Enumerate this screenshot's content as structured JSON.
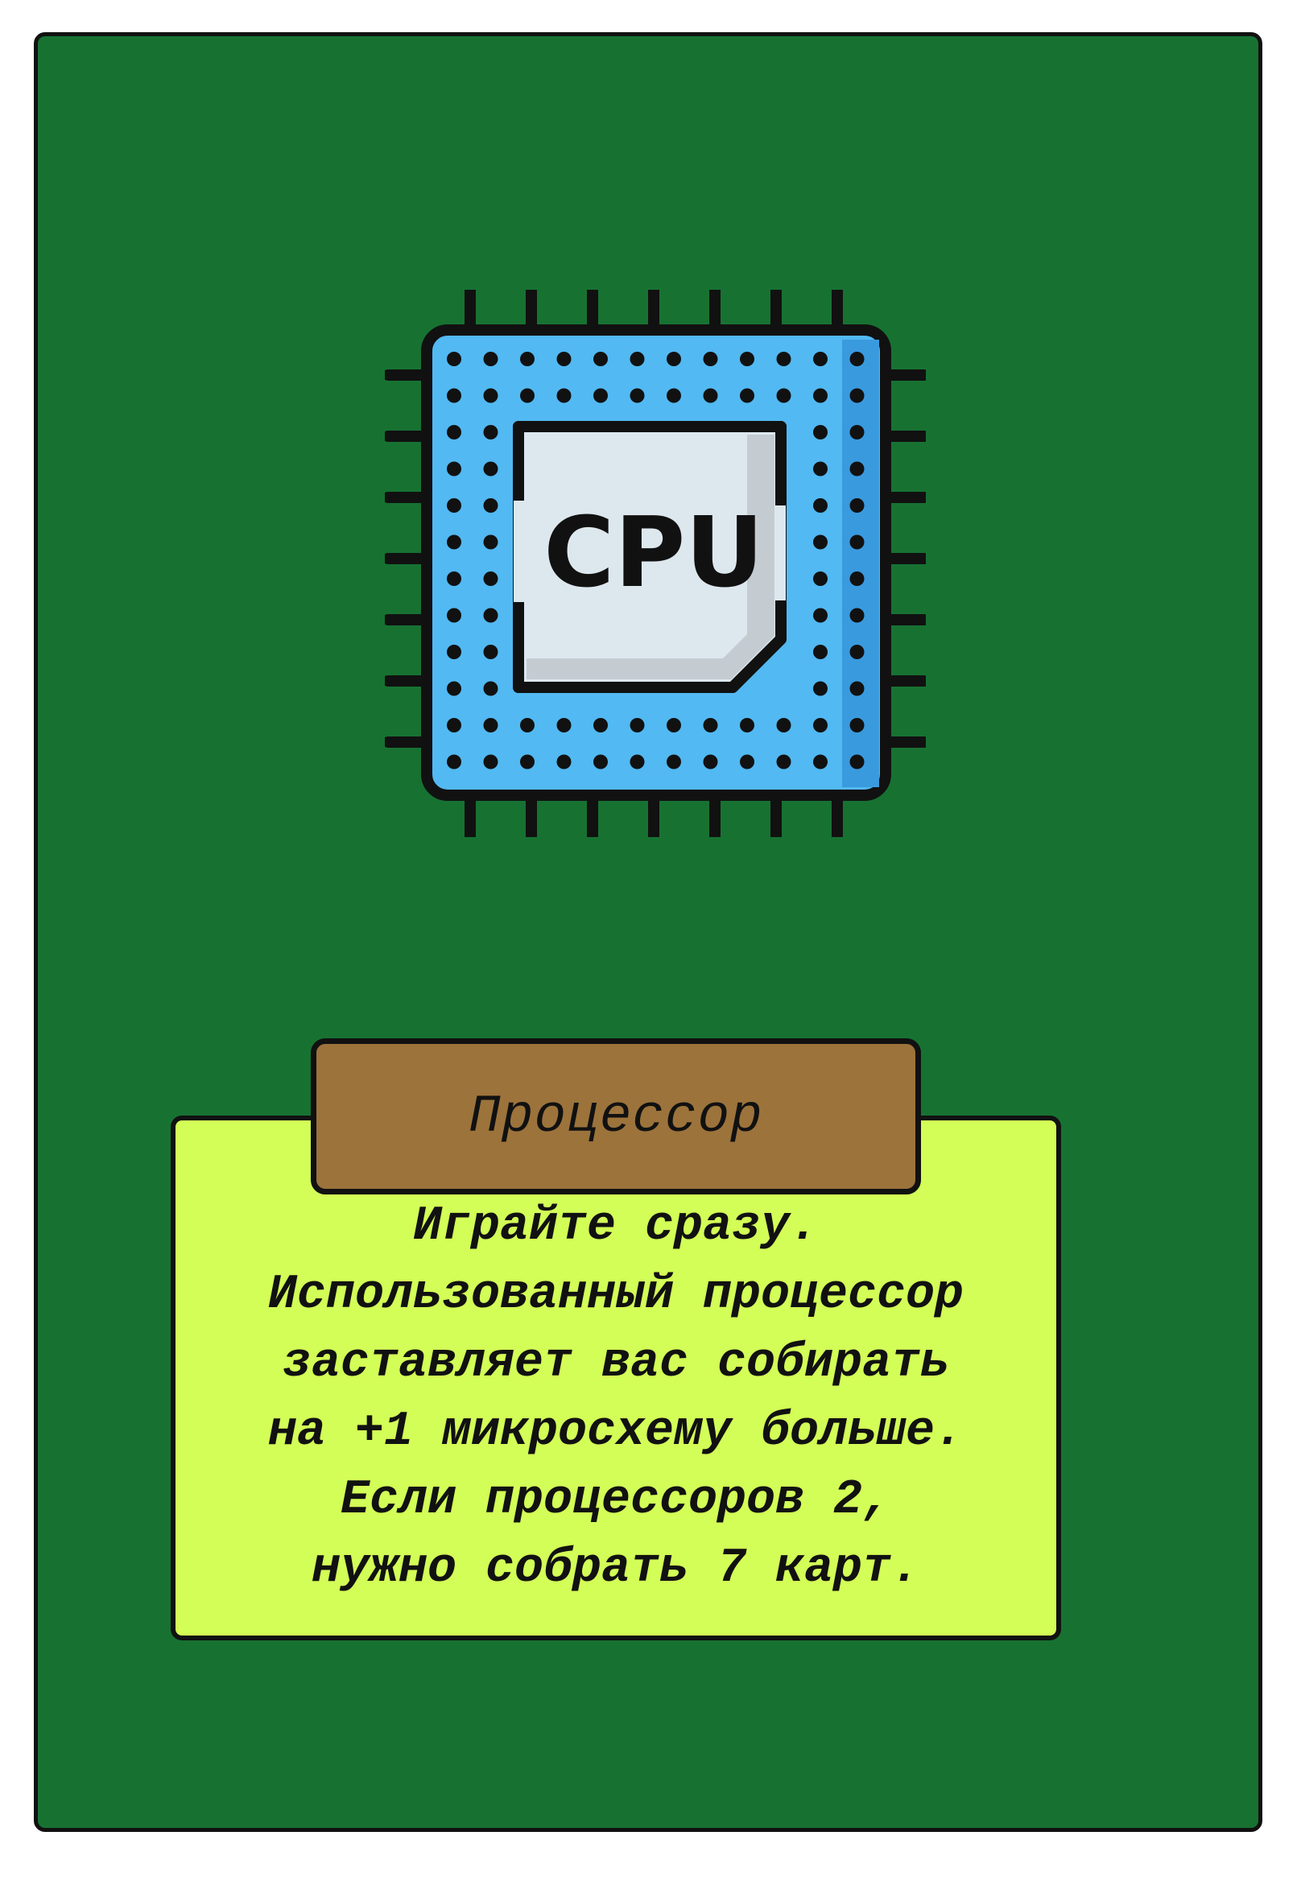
{
  "card": {
    "background_color": "#177232",
    "icon": {
      "name": "cpu-chip-icon",
      "label": "CPU",
      "chip_color": "#52b9f2",
      "die_color": "#dde8ee"
    },
    "title": "Процессор",
    "title_color": "#9c733b",
    "description_color": "#d3fd57",
    "description_lines": [
      "Играйте сразу.",
      "Использованный процессор",
      "заставляет вас собирать",
      "на +1 микросхему больше.",
      "Если процессоров 2,",
      "нужно собрать 7 карт."
    ]
  }
}
